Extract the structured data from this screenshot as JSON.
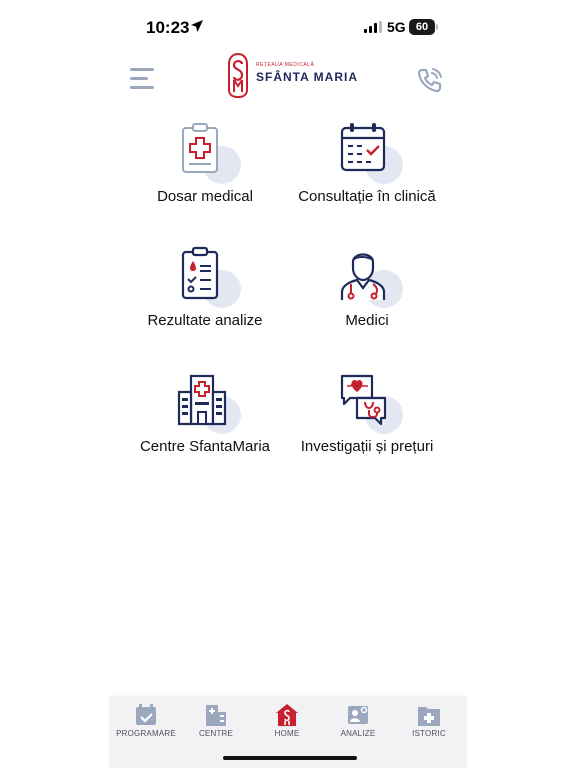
{
  "status_bar": {
    "time": "10:23",
    "network": "5G",
    "battery": "60"
  },
  "header": {
    "logo_small": "REȚEAUA MEDICALĂ",
    "logo_big": "SFÂNTA MARIA"
  },
  "menu": [
    {
      "label": "Dosar medical",
      "icon": "medical-record-icon"
    },
    {
      "label": "Consultație în clinică",
      "icon": "calendar-icon"
    },
    {
      "label": "Rezultate analize",
      "icon": "lab-results-icon"
    },
    {
      "label": "Medici",
      "icon": "doctor-icon"
    },
    {
      "label": "Centre SfantaMaria",
      "icon": "hospital-icon"
    },
    {
      "label": "Investigații și prețuri",
      "icon": "investigations-icon"
    }
  ],
  "tabbar": [
    {
      "label": "PROGRAMARE",
      "icon": "calendar-check-icon"
    },
    {
      "label": "CENTRE",
      "icon": "hospital-building-icon"
    },
    {
      "label": "HOME",
      "icon": "home-icon",
      "active": true
    },
    {
      "label": "ANALIZE",
      "icon": "analysis-icon"
    },
    {
      "label": "ISTORIC",
      "icon": "history-folder-icon"
    }
  ],
  "colors": {
    "navy": "#1e2a5a",
    "red": "#c8202e",
    "light": "#9aa7bd",
    "accent_bg": "#e3e7f1"
  }
}
